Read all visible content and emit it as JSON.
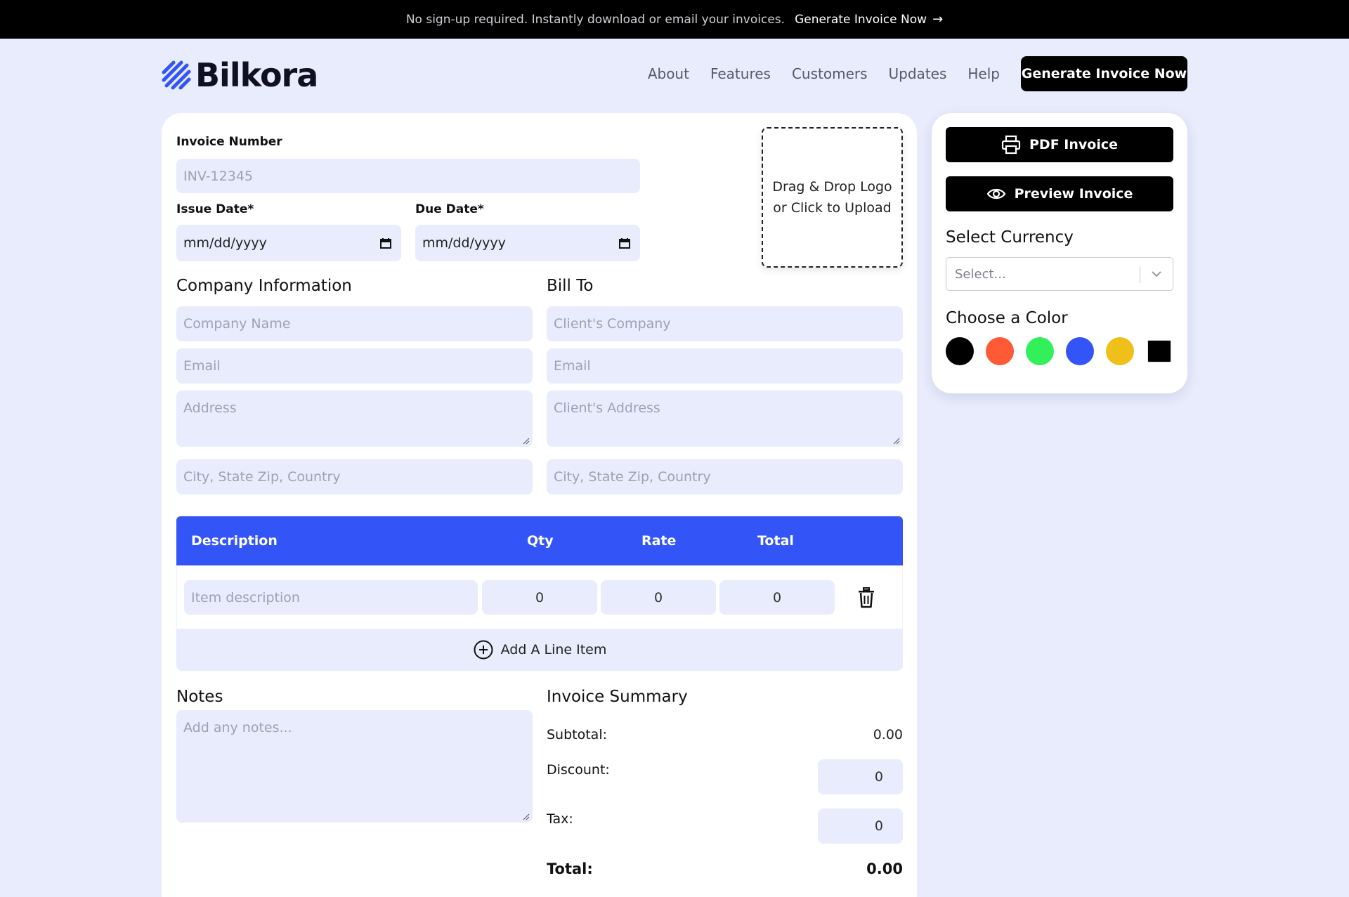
{
  "topbar": {
    "message": "No sign-up required. Instantly download or email your invoices.",
    "cta_label": "Generate Invoice Now",
    "cta_arrow": "→"
  },
  "brand": {
    "name": "Bilkora",
    "logo_icon": "striped-diamond-logo"
  },
  "nav": {
    "links": [
      "About",
      "Features",
      "Customers",
      "Updates",
      "Help"
    ],
    "cta_label": "Generate Invoice Now"
  },
  "invoice": {
    "number_label": "Invoice Number",
    "number_placeholder": "INV-12345",
    "issue_date_label": "Issue Date*",
    "issue_date_placeholder": "mm/dd/yyyy",
    "due_date_label": "Due Date*",
    "due_date_placeholder": "mm/dd/yyyy",
    "logo_upload_text": "Drag & Drop Logo or Click to Upload"
  },
  "company": {
    "heading": "Company Information",
    "name_placeholder": "Company Name",
    "email_placeholder": "Email",
    "address_placeholder": "Address",
    "city_placeholder": "City, State Zip, Country"
  },
  "bill_to": {
    "heading": "Bill To",
    "company_placeholder": "Client's Company",
    "email_placeholder": "Email",
    "address_placeholder": "Client's Address",
    "city_placeholder": "City, State Zip, Country"
  },
  "items": {
    "columns": [
      "Description",
      "Qty",
      "Rate",
      "Total"
    ],
    "rows": [
      {
        "description_placeholder": "Item description",
        "qty": "0",
        "rate": "0",
        "total": "0"
      }
    ],
    "add_label": "Add A Line Item"
  },
  "notes": {
    "heading": "Notes",
    "placeholder": "Add any notes..."
  },
  "summary": {
    "heading": "Invoice Summary",
    "subtotal_label": "Subtotal:",
    "subtotal_value": "0.00",
    "discount_label": "Discount:",
    "discount_value": "0",
    "tax_label": "Tax:",
    "tax_value": "0",
    "total_label": "Total:",
    "total_value": "0.00"
  },
  "sidebar": {
    "pdf_label": "PDF Invoice",
    "preview_label": "Preview Invoice",
    "currency_heading": "Select Currency",
    "currency_placeholder": "Select...",
    "color_heading": "Choose a Color",
    "colors": [
      "#000000",
      "#ff5a36",
      "#33f05a",
      "#3355f8",
      "#f0c01a",
      "#000000"
    ]
  }
}
